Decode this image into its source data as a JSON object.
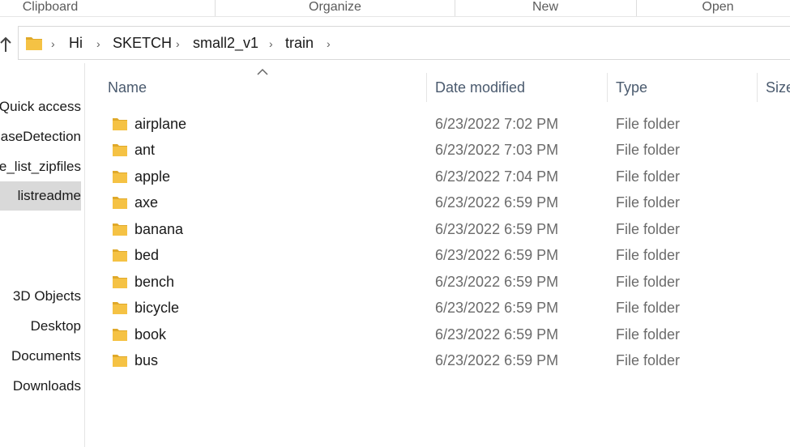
{
  "ribbon": {
    "groups": [
      "Clipboard",
      "Organize",
      "New",
      "Open"
    ]
  },
  "address": {
    "folder_icon": "folder-icon",
    "crumbs": [
      "Hi",
      "SKETCH",
      "small2_v1",
      "train"
    ]
  },
  "sidebar": {
    "items": [
      {
        "label": "Quick access"
      },
      {
        "label": "DiseaseDetection"
      },
      {
        "label": "file_list_zipfiles"
      },
      {
        "label": "listreadme"
      },
      {
        "label": "3D Objects"
      },
      {
        "label": "Desktop"
      },
      {
        "label": "Documents"
      },
      {
        "label": "Downloads"
      }
    ],
    "selected_index": 3
  },
  "columns": {
    "name": "Name",
    "date": "Date modified",
    "type": "Type",
    "size": "Size"
  },
  "files": [
    {
      "name": "airplane",
      "date": "6/23/2022 7:02 PM",
      "type": "File folder"
    },
    {
      "name": "ant",
      "date": "6/23/2022 7:03 PM",
      "type": "File folder"
    },
    {
      "name": "apple",
      "date": "6/23/2022 7:04 PM",
      "type": "File folder"
    },
    {
      "name": "axe",
      "date": "6/23/2022 6:59 PM",
      "type": "File folder"
    },
    {
      "name": "banana",
      "date": "6/23/2022 6:59 PM",
      "type": "File folder"
    },
    {
      "name": "bed",
      "date": "6/23/2022 6:59 PM",
      "type": "File folder"
    },
    {
      "name": "bench",
      "date": "6/23/2022 6:59 PM",
      "type": "File folder"
    },
    {
      "name": "bicycle",
      "date": "6/23/2022 6:59 PM",
      "type": "File folder"
    },
    {
      "name": "book",
      "date": "6/23/2022 6:59 PM",
      "type": "File folder"
    },
    {
      "name": "bus",
      "date": "6/23/2022 6:59 PM",
      "type": "File folder"
    }
  ],
  "colors": {
    "folder": "#f5c244",
    "folder_dark": "#e0a92a",
    "selected": "#d9d9d9"
  }
}
